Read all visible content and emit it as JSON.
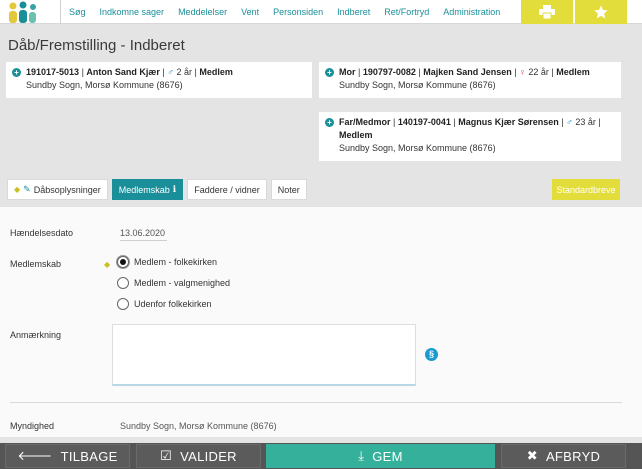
{
  "nav": {
    "items": [
      "Søg",
      "Indkomne sager",
      "Meddelelser",
      "Vent",
      "Personsiden",
      "Indberet",
      "Ret/Fortryd",
      "Administration"
    ]
  },
  "page": {
    "title": "Dåb/Fremstilling - Indberet"
  },
  "persons": {
    "child": {
      "cpr": "191017-5013",
      "name": "Anton Sand Kjær",
      "age": "2 år",
      "status": "Medlem",
      "location": "Sundby Sogn, Morsø Kommune (8676)"
    },
    "mother": {
      "role": "Mor",
      "cpr": "190797-0082",
      "name": "Majken Sand Jensen",
      "age": "22 år",
      "status": "Medlem",
      "location": "Sundby Sogn, Morsø Kommune (8676)"
    },
    "father": {
      "role": "Far/Medmor",
      "cpr": "140197-0041",
      "name": "Magnus Kjær Sørensen",
      "age": "23 år",
      "status": "Medlem",
      "location": "Sundby Sogn, Morsø Kommune (8676)"
    }
  },
  "tabs": {
    "items": [
      "Dåbsoplysninger",
      "Medlemskab",
      "Faddere / vidner",
      "Noter"
    ],
    "active_index": 1,
    "standardbreve": "Standardbreve"
  },
  "form": {
    "event_date_label": "Hændelsesdato",
    "event_date": "13.06.2020",
    "membership_label": "Medlemskab",
    "membership_options": [
      "Medlem - folkekirken",
      "Medlem - valgmenighed",
      "Udenfor folkekirken"
    ],
    "membership_selected": 0,
    "remark_label": "Anmærkning",
    "remark_value": "",
    "authority_label": "Myndighed",
    "authority_value": "Sundby Sogn, Morsø Kommune (8676)"
  },
  "actions": {
    "back": "TILBAGE",
    "validate": "VALIDER",
    "save": "GEM",
    "cancel": "AFBRYD"
  },
  "colors": {
    "accent": "#1a8f9a",
    "yellow": "#e3dd3c",
    "green": "#35b09a",
    "bar": "#5b5b5b"
  }
}
